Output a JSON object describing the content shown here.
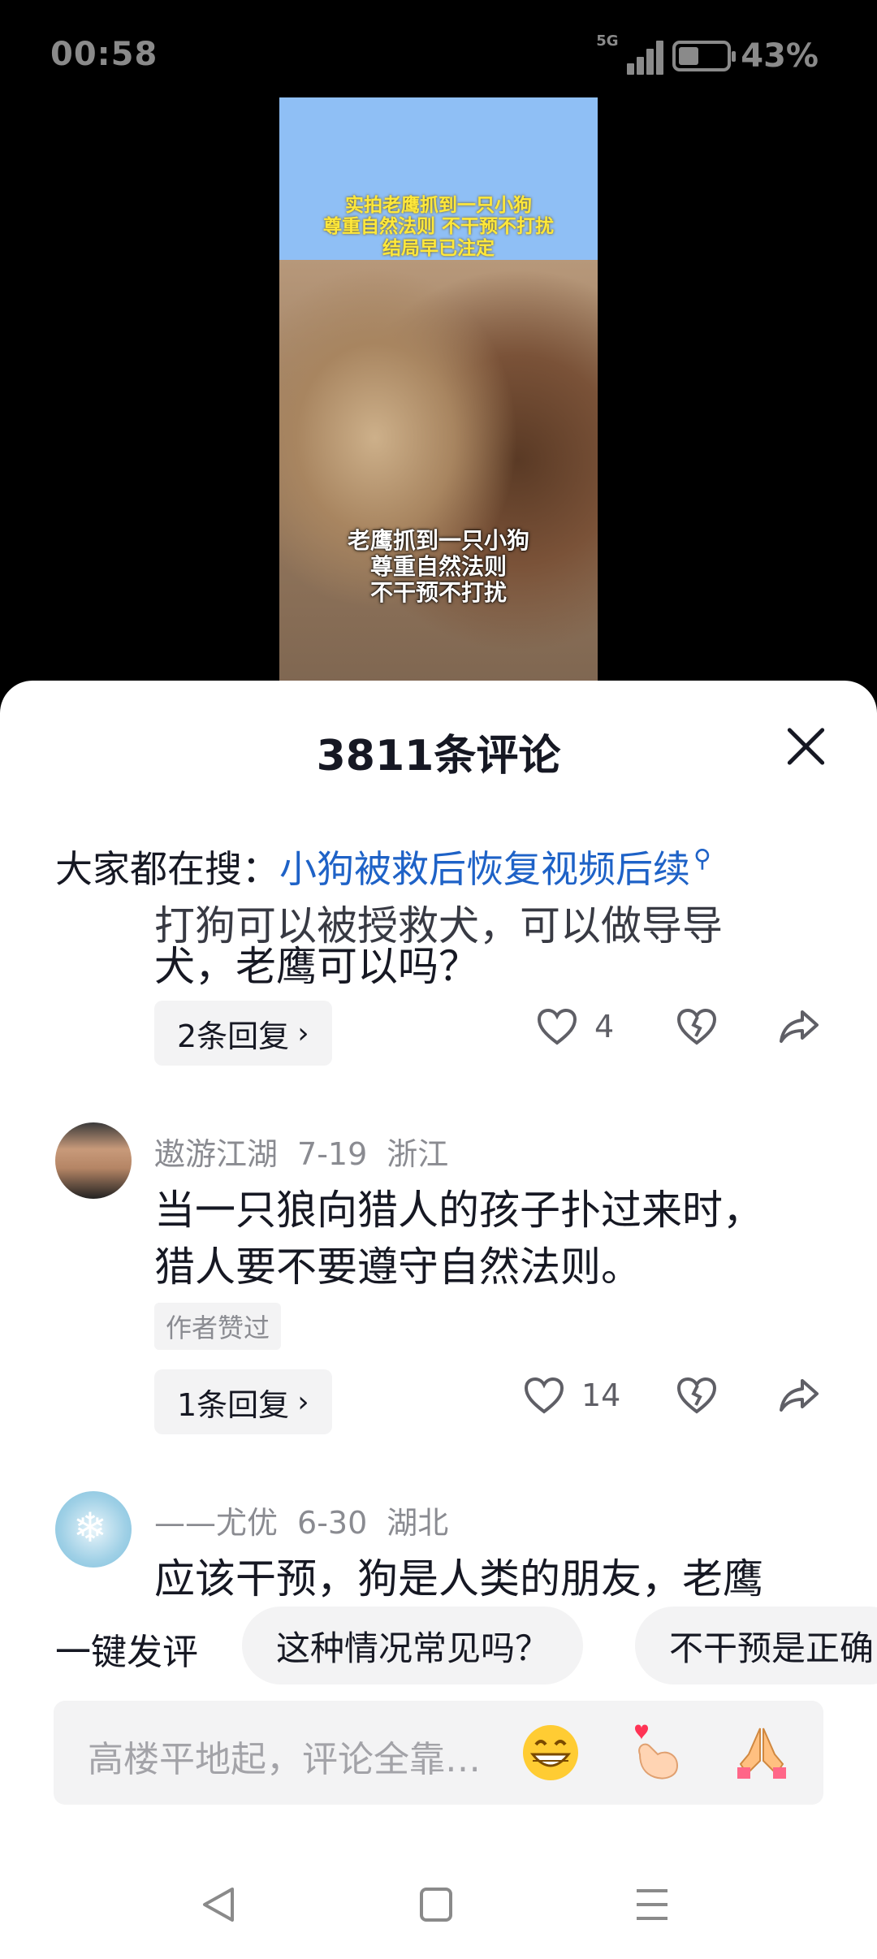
{
  "status_bar": {
    "time": "00:58",
    "network": "5G",
    "battery": "43%",
    "battery_level": 0.43
  },
  "video": {
    "top_caption": [
      "实拍老鹰抓到一只小狗",
      "尊重自然法则 不干预不打扰",
      "结局早已注定"
    ],
    "bottom_caption": [
      "老鹰抓到一只小狗",
      "尊重自然法则",
      "不干预不打扰"
    ]
  },
  "sheet": {
    "title": "3811条评论",
    "search_prefix": "大家都在搜：",
    "search_link": "小狗被救后恢复视频后续"
  },
  "comments": [
    {
      "clipped_top": "打狗可以被授救犬，可以做导导",
      "text_lines": [
        "犬，老鹰可以吗？"
      ],
      "replies": "2条回复",
      "likes": "4"
    },
    {
      "author": "遨游江湖",
      "date": "7-19",
      "location": "浙江",
      "text_lines": [
        "当一只狼向猎人的孩子扑过来时，",
        "猎人要不要遵守自然法则。"
      ],
      "badge": "作者赞过",
      "replies": "1条回复",
      "likes": "14"
    },
    {
      "author": "——尤优",
      "date": "6-30",
      "location": "湖北",
      "text_lines": [
        "应该干预，狗是人类的朋友，老鹰"
      ]
    }
  ],
  "quick_comment": {
    "label": "一键发评",
    "chips": [
      "这种情况常见吗？",
      "不干预是正确"
    ]
  },
  "input": {
    "placeholder": "高楼平地起，评论全靠…"
  },
  "icons": {
    "like": "heart-outline-icon",
    "dislike": "broken-heart-icon",
    "share": "share-arrow-icon",
    "emoji": [
      "grinning-face-emoji",
      "finger-heart-emoji",
      "folded-hands-emoji"
    ],
    "nav": [
      "back-triangle-icon",
      "home-square-icon",
      "menu-lines-icon"
    ]
  }
}
